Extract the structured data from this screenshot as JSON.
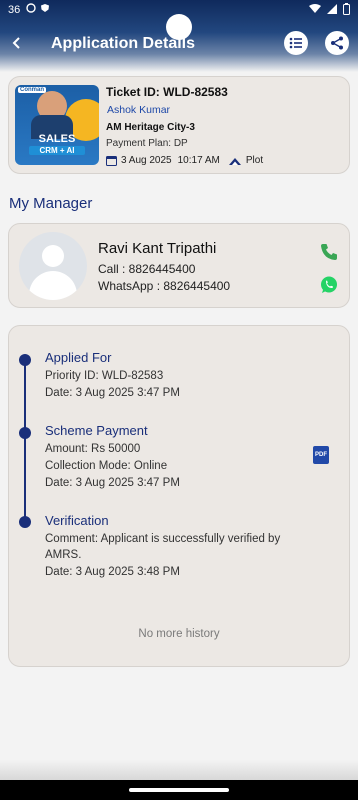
{
  "status_bar": {
    "time": "36"
  },
  "header": {
    "title": "Application Details",
    "back_icon": "arrow-left-icon",
    "list_icon": "list-icon",
    "share_icon": "share-icon"
  },
  "ticket": {
    "thumbnail": {
      "badge": "Conman",
      "line1": "SALES",
      "line2": "CRM + AI"
    },
    "ticket_id": "Ticket ID: WLD-82583",
    "applicant_name": "Ashok Kumar",
    "project": "AM Heritage City-3",
    "payment_plan": "Payment Plan: DP",
    "date": "3 Aug 2025",
    "time": "10:17 AM",
    "property_type": "Plot"
  },
  "manager_section": {
    "title": "My Manager",
    "name": "Ravi Kant Tripathi",
    "call": "Call : 8826445400",
    "whatsapp": "WhatsApp : 8826445400",
    "colors": {
      "phone": "#3aa655",
      "whatsapp": "#25d366"
    }
  },
  "history": {
    "events": [
      {
        "title": "Applied For",
        "lines": [
          "Priority ID: WLD-82583",
          "Date: 3 Aug 2025  3:47 PM"
        ]
      },
      {
        "title": "Scheme Payment",
        "lines": [
          "Amount: Rs 50000",
          "Collection Mode: Online",
          "Date: 3 Aug 2025  3:47 PM"
        ],
        "attachment": "PDF"
      },
      {
        "title": "Verification",
        "lines": [
          "Comment: Applicant is successfully verified by",
          "AMRS.",
          "Date: 3 Aug 2025  3:48 PM"
        ]
      }
    ],
    "footer": "No more history"
  },
  "colors": {
    "accent": "#1a2f7a",
    "link": "#1f49a8",
    "header_dark": "#0f2a5c"
  }
}
